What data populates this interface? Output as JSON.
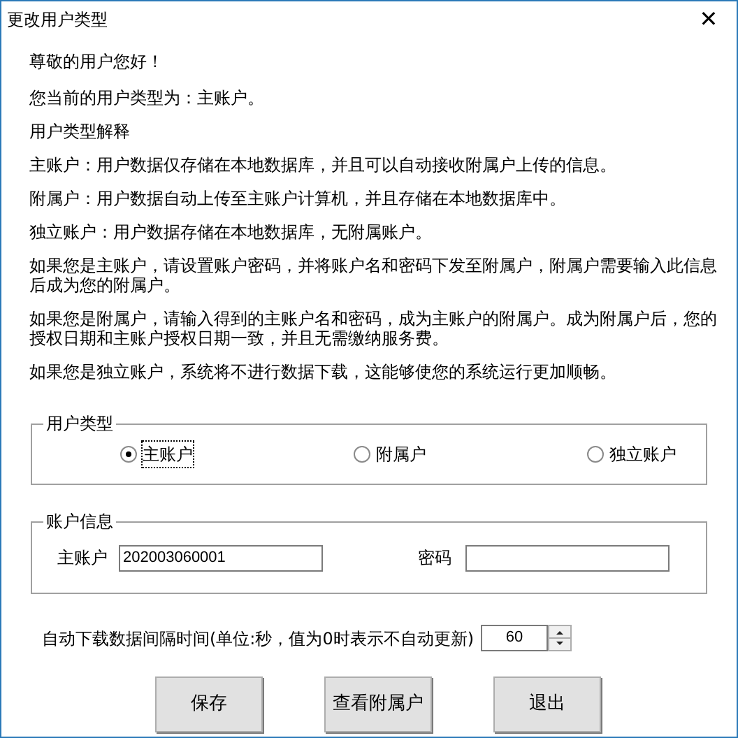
{
  "window": {
    "title": "更改用户类型",
    "close": "✕"
  },
  "paragraphs": [
    "尊敬的用户您好！",
    "您当前的用户类型为：主账户。",
    "用户类型解释",
    "主账户：用户数据仅存储在本地数据库，并且可以自动接收附属户上传的信息。",
    "附属户：用户数据自动上传至主账户计算机，并且存储在本地数据库中。",
    "独立账户：用户数据存储在本地数据库，无附属账户。",
    "如果您是主账户，请设置账户密码，并将账户名和密码下发至附属户，附属户需要输入此信息后成为您的附属户。",
    "如果您是附属户，请输入得到的主账户名和密码，成为主账户的附属户。成为附属户后，您的授权日期和主账户授权日期一致，并且无需缴纳服务费。",
    "如果您是独立账户，系统将不进行数据下载，这能够使您的系统运行更加顺畅。"
  ],
  "user_type": {
    "title": "用户类型",
    "options": [
      {
        "label": "主账户",
        "selected": true
      },
      {
        "label": "附属户",
        "selected": false
      },
      {
        "label": "独立账户",
        "selected": false
      }
    ]
  },
  "account_info": {
    "title": "账户信息",
    "main_account_label": "主账户",
    "main_account": "202003060001",
    "password_label": "密码"
  },
  "interval": {
    "label": "自动下载数据间隔时间(单位:秒，值为0时表示不自动更新)",
    "value": "60"
  },
  "buttons": [
    "保存",
    "查看附属户",
    "退出"
  ]
}
